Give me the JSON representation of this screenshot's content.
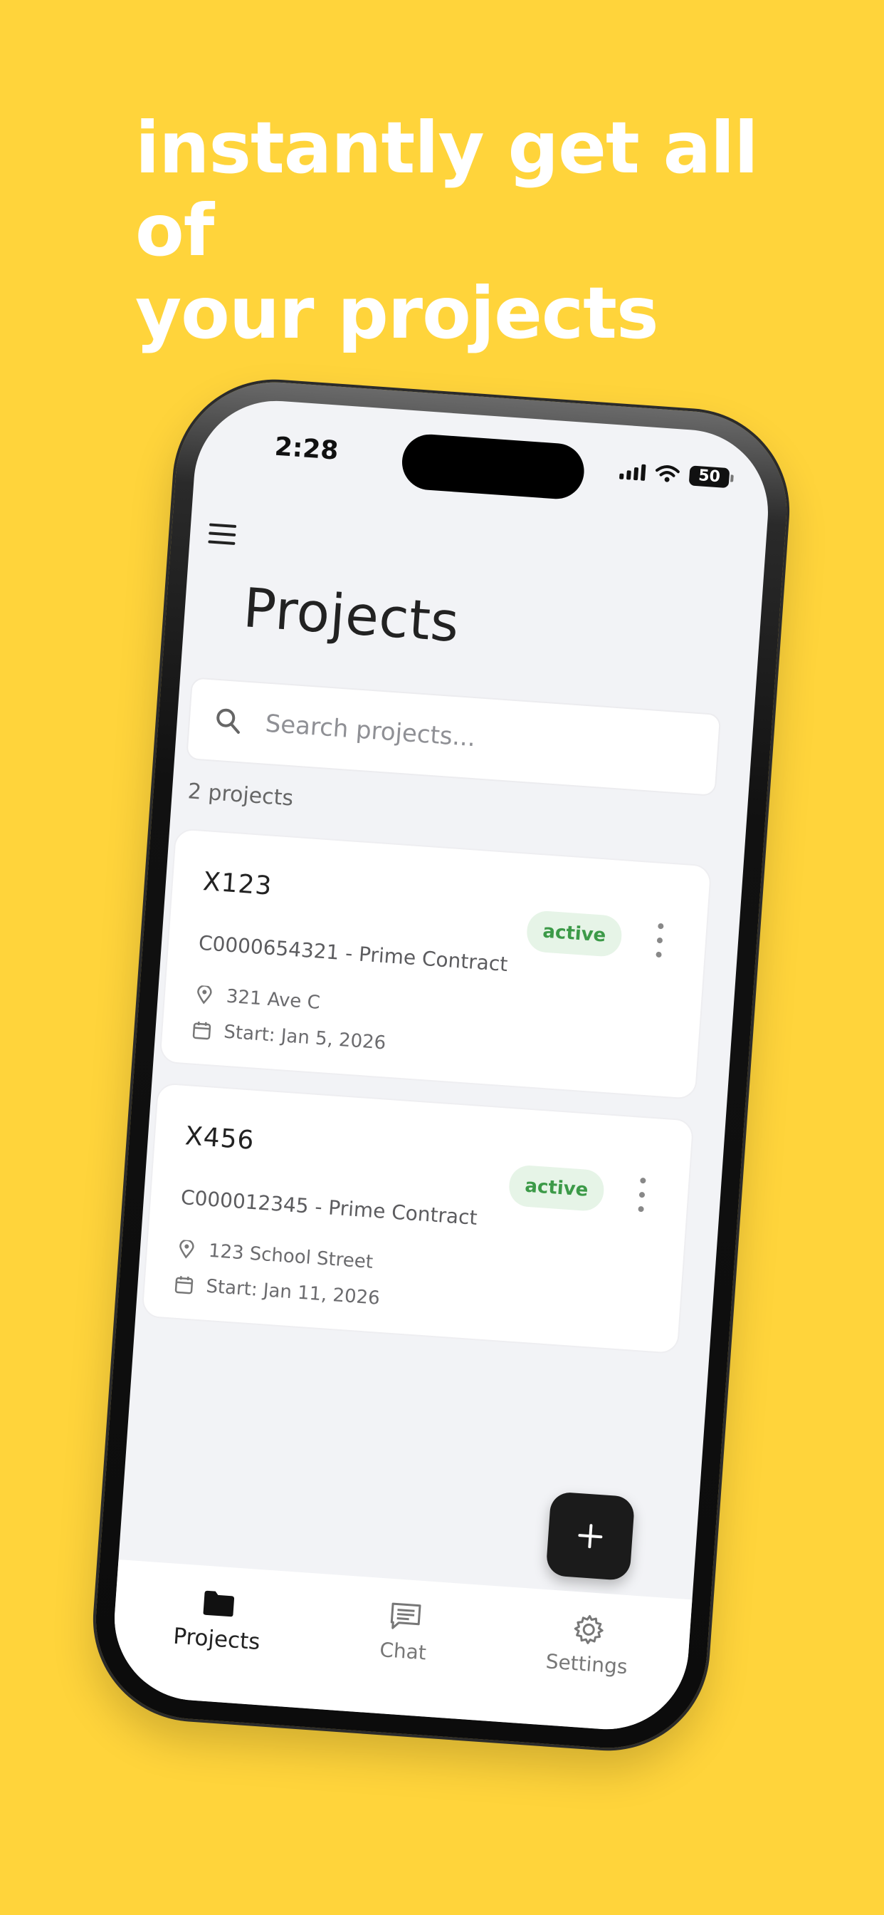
{
  "promo": {
    "headline_line1": "instantly get all of",
    "headline_line2": "your projects",
    "background_color": "#FFD43B"
  },
  "status_bar": {
    "time": "2:28",
    "battery": "50"
  },
  "header": {
    "menu_icon": "hamburger-icon",
    "title": "Projects"
  },
  "search": {
    "placeholder": "Search projects..."
  },
  "list": {
    "count_label": "2 projects",
    "projects": [
      {
        "name": "X123",
        "contract": "C0000654321 - Prime Contract",
        "address": "321 Ave C",
        "start": "Start: Jan 5, 2026",
        "status": "active"
      },
      {
        "name": "X456",
        "contract": "C000012345 - Prime Contract",
        "address": "123 School Street",
        "start": "Start: Jan 11, 2026",
        "status": "active"
      }
    ]
  },
  "fab": {
    "icon": "plus-icon"
  },
  "nav": {
    "items": [
      {
        "label": "Projects",
        "icon": "folder-icon",
        "active": true
      },
      {
        "label": "Chat",
        "icon": "chat-icon",
        "active": false
      },
      {
        "label": "Settings",
        "icon": "gear-icon",
        "active": false
      }
    ]
  },
  "colors": {
    "status_active_bg": "#E6F4E7",
    "status_active_text": "#3C9A48",
    "fab_bg": "#1B1B1B"
  }
}
